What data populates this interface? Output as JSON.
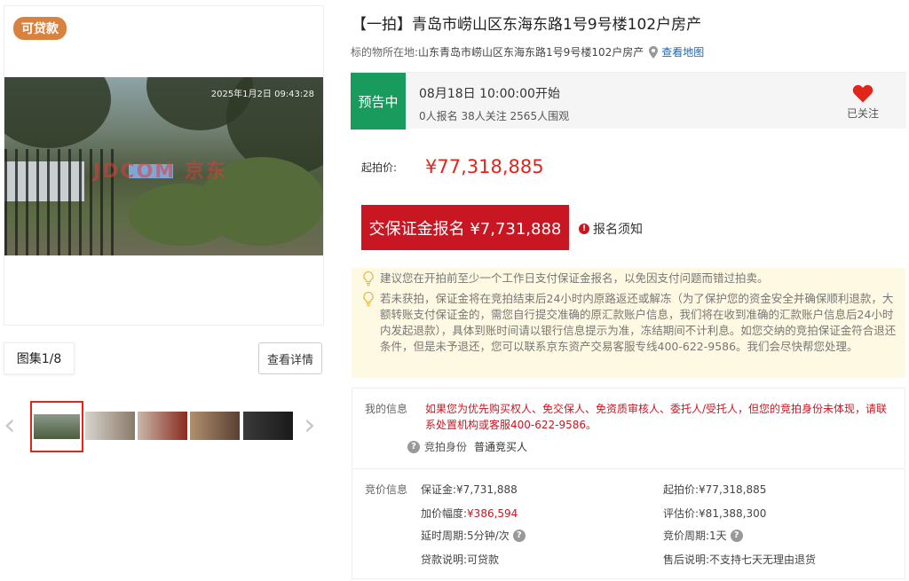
{
  "gallery": {
    "loan_badge": "可贷款",
    "photo_timestamp": "2025年1月2日 09:43:28",
    "watermark": "JDCOM 京东",
    "album_label": "图集1/8",
    "detail_button": "查看详情",
    "prev_arrow": "‹",
    "next_arrow": "›"
  },
  "header": {
    "title": "【一拍】青岛市崂山区东海东路1号9号楼102户房产",
    "location_label": "标的物所在地:",
    "location_address": "山东青岛市崂山区东海东路1号9号楼102户房产",
    "map_link": "查看地图"
  },
  "status": {
    "tag": "预告中",
    "start_time": "08月18日 10:00:00开始",
    "stats": "0人报名 38人关注 2565人围观",
    "follow_label": "已关注",
    "colors": {
      "tag_bg": "#1a9b5e",
      "heart": "#e1251b"
    }
  },
  "price": {
    "label": "起拍价:",
    "value": "¥77,318,885"
  },
  "actions": {
    "deposit_button": "交保证金报名 ¥7,731,888",
    "notice_link": "报名须知",
    "notice_icon": "!"
  },
  "tips": [
    "建议您在开拍前至少一个工作日支付保证金报名，以免因支付问题而错过拍卖。",
    "若未获拍，保证金将在竞拍结束后24小时内原路返还或解冻（为了保护您的资金安全并确保顺利退款，大额转账支付保证金的，需您自行提交准确的原汇款账户信息，我们将在收到准确的汇款账户信息后24小时内发起退款），具体到账时间请以银行信息提示为准，冻结期间不计利息。如您交纳的竞拍保证金符合退还条件，但是未予退还，您可以联系京东资产交易客服专线400-622-9586。我们会尽快帮您处理。"
  ],
  "my_info": {
    "label": "我的信息",
    "warning": "如果您为优先购买权人、免交保人、免资质审核人、委托人/受托人，但您的竞拍身份未体现，请联系处置机构或客服400-622-9586。",
    "identity_label": "竞拍身份",
    "identity_value": "普通竞买人"
  },
  "bid_info": {
    "label": "竞价信息",
    "deposit_label": "保证金:",
    "deposit_value": "¥7,731,888",
    "start_label": "起拍价:",
    "start_value": "¥77,318,885",
    "increment_label": "加价幅度:",
    "increment_value": "¥386,594",
    "appraisal_label": "评估价:",
    "appraisal_value": "¥81,388,300",
    "delay_label": "延时周期:",
    "delay_value": "5分钟/次",
    "cycle_label": "竞价周期:",
    "cycle_value": "1天",
    "loan_label": "贷款说明:",
    "loan_value": "可贷款",
    "aftersale_label": "售后说明:",
    "aftersale_value": "不支持七天无理由退货"
  }
}
